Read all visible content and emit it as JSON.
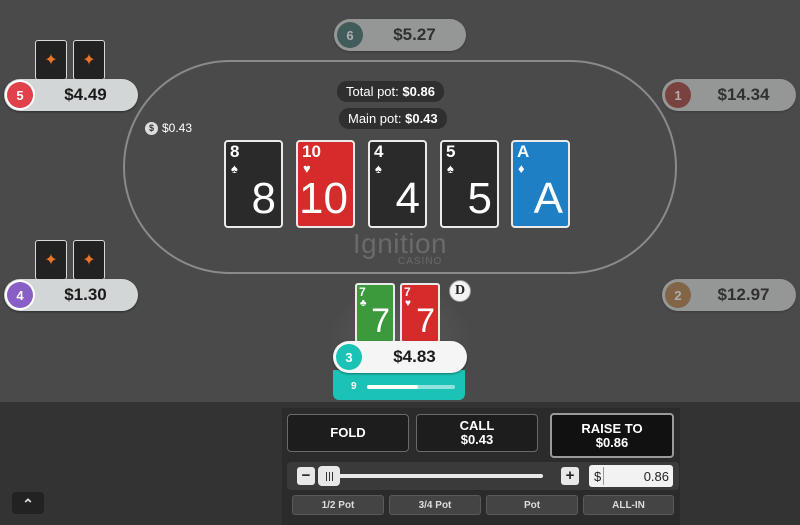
{
  "table": {
    "total_pot_label": "Total pot:",
    "total_pot_value": "$0.86",
    "main_pot_label": "Main pot:",
    "main_pot_value": "$0.43",
    "bet_chip": "$0.43",
    "logo_main": "Ignition",
    "logo_sub": "CASINO",
    "dealer_button": "D"
  },
  "seats": [
    {
      "num": "6",
      "stack": "$5.27",
      "color": "#3d6b6a"
    },
    {
      "num": "5",
      "stack": "$4.49",
      "color": "#e0414b"
    },
    {
      "num": "1",
      "stack": "$14.34",
      "color": "#a03c35"
    },
    {
      "num": "4",
      "stack": "$1.30",
      "color": "#8a5ec7"
    },
    {
      "num": "2",
      "stack": "$12.97",
      "color": "#b07a45"
    },
    {
      "num": "3",
      "stack": "$4.83",
      "color": "#1bc3b6"
    }
  ],
  "hero": {
    "timer_value": "9",
    "timer_progress": 0.58
  },
  "board": [
    {
      "rank": "8",
      "suit": "♠",
      "suit_name": "spade",
      "color": "#2a2a2a"
    },
    {
      "rank": "10",
      "suit": "♥",
      "suit_name": "heart",
      "color": "#d52b2b"
    },
    {
      "rank": "4",
      "suit": "♠",
      "suit_name": "spade",
      "color": "#2a2a2a"
    },
    {
      "rank": "5",
      "suit": "♠",
      "suit_name": "spade",
      "color": "#2a2a2a"
    },
    {
      "rank": "A",
      "suit": "♦",
      "suit_name": "diamond",
      "color": "#1f7fc4"
    }
  ],
  "hole_cards": [
    {
      "rank": "7",
      "suit": "♣",
      "suit_name": "club",
      "color": "#3c9a3c"
    },
    {
      "rank": "7",
      "suit": "♥",
      "suit_name": "heart",
      "color": "#d52b2b"
    }
  ],
  "actions": {
    "fold": "FOLD",
    "call_label": "CALL",
    "call_amount": "$0.43",
    "raise_label": "RAISE TO",
    "raise_amount": "$0.86"
  },
  "bet_input": {
    "currency": "$",
    "value": "0.86",
    "slider_fraction": 0.0
  },
  "presets": [
    "1/2 Pot",
    "3/4 Pot",
    "Pot",
    "ALL-IN"
  ],
  "icons": {
    "card_back": "ignition-logo-icon",
    "minus": "−",
    "plus": "+",
    "chip": "$",
    "expand": "⌃"
  }
}
